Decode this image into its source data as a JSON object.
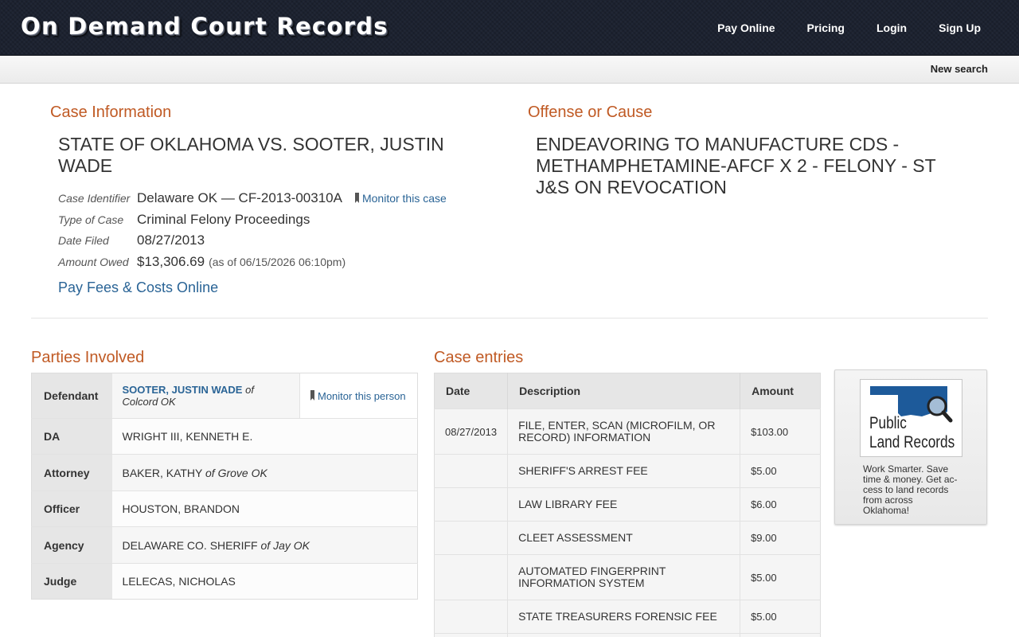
{
  "site": {
    "logo": "On Demand Court Records",
    "nav": [
      "Pay Online",
      "Pricing",
      "Login",
      "Sign Up"
    ],
    "subnav": "New search"
  },
  "case": {
    "section_title": "Case Information",
    "title": "STATE OF OKLAHOMA VS. SOOTER, JUSTIN WADE",
    "rows": [
      {
        "label": "Case Identifier",
        "value": "Delaware OK — CF-2013-00310A"
      },
      {
        "label": "Type of Case",
        "value": "Criminal Felony Proceedings"
      },
      {
        "label": "Date Filed",
        "value": "08/27/2013"
      },
      {
        "label": "Amount Owed",
        "value": "$13,306.69",
        "note": "(as of 06/15/2026 06:10pm)"
      }
    ],
    "monitor_link": "Monitor this case",
    "pay_link": "Pay Fees & Costs Online"
  },
  "offense": {
    "section_title": "Offense or Cause",
    "text": "ENDEAVORING TO MANUFACTURE CDS - METHAMPHETAMINE-AFCF X 2 - FELONY - ST J&S ON REVOCATION"
  },
  "parties": {
    "section_title": "Parties Involved",
    "defendant": {
      "label": "Defendant",
      "name": "SOOTER, JUSTIN WADE",
      "of": "of",
      "place": "Colcord OK",
      "monitor": "Monitor this person"
    },
    "rows": [
      {
        "label": "DA",
        "name": "WRIGHT III, KENNETH E.",
        "of": "",
        "place": ""
      },
      {
        "label": "Attorney",
        "name": "BAKER, KATHY",
        "of": "of",
        "place": "Grove OK"
      },
      {
        "label": "Officer",
        "name": "HOUSTON, BRANDON",
        "of": "",
        "place": ""
      },
      {
        "label": "Agency",
        "name": "DELAWARE CO. SHERIFF",
        "of": "of",
        "place": "Jay OK"
      },
      {
        "label": "Judge",
        "name": "LELECAS, NICHOLAS",
        "of": "",
        "place": ""
      }
    ]
  },
  "entries": {
    "section_title": "Case entries",
    "headers": [
      "Date",
      "Description",
      "Amount"
    ],
    "rows": [
      {
        "date": "08/27/2013",
        "description": "FILE, ENTER, SCAN (MICROFILM, OR RECORD) INFORMATION",
        "amount": "$103.00"
      },
      {
        "date": "",
        "description": "SHERIFF'S ARREST FEE",
        "amount": "$5.00"
      },
      {
        "date": "",
        "description": "LAW LIBRARY FEE",
        "amount": "$6.00"
      },
      {
        "date": "",
        "description": "CLEET ASSESSMENT",
        "amount": "$9.00"
      },
      {
        "date": "",
        "description": "AUTOMATED FINGERPRINT INFORMATION SYSTEM",
        "amount": "$5.00"
      },
      {
        "date": "",
        "description": "STATE TREASURERS FORENSIC FEE",
        "amount": "$5.00"
      }
    ]
  },
  "ad": {
    "logo_line1": "Public",
    "logo_line2": "Land Records",
    "text": "Work Smarter. Save time & money. Get ac-cess to land records from across Oklahoma!",
    "colors": {
      "state": "#1d5a9a"
    }
  }
}
